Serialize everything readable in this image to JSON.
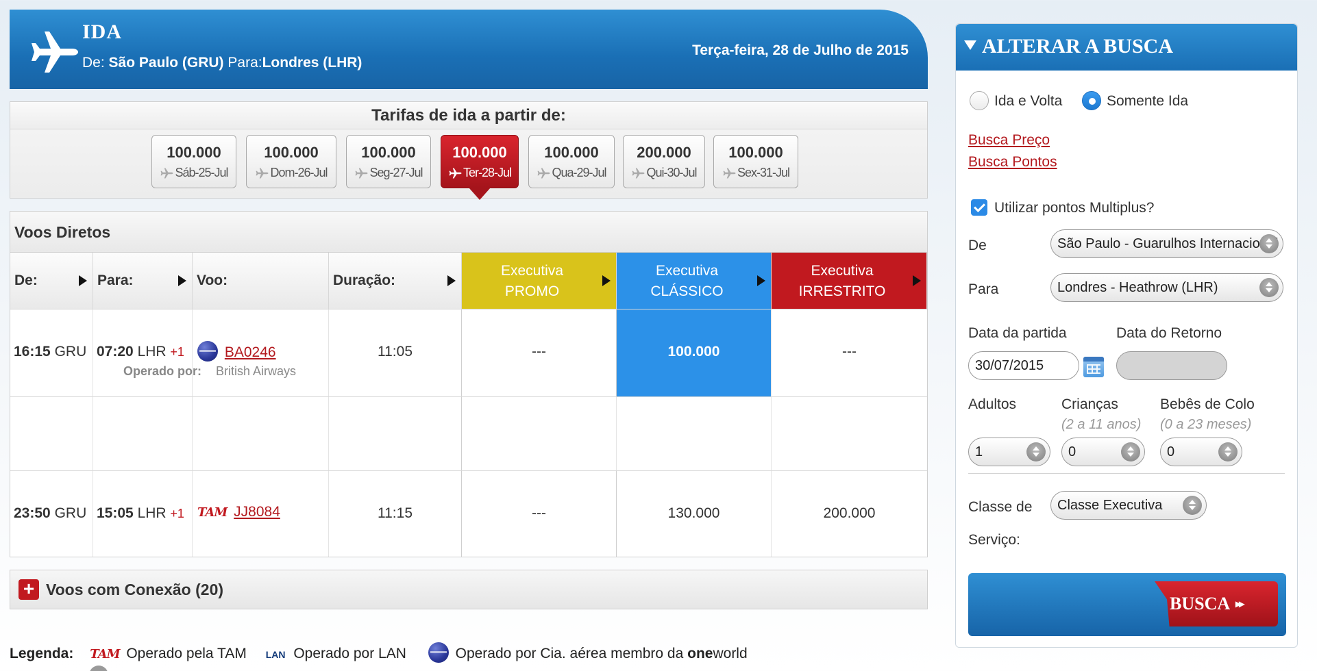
{
  "header": {
    "title": "IDA",
    "route_from_label": "De:",
    "route_from": "São Paulo (GRU)",
    "route_to_label": "Para:",
    "route_to": "Londres (LHR)",
    "date": "Terça-feira, 28 de Julho de 2015"
  },
  "fares": {
    "title": "Tarifas de ida a partir de:",
    "items": [
      {
        "value": "100.000",
        "date": "Sáb-25-Jul",
        "active": false
      },
      {
        "value": "100.000",
        "date": "Dom-26-Jul",
        "active": false
      },
      {
        "value": "100.000",
        "date": "Seg-27-Jul",
        "active": false
      },
      {
        "value": "100.000",
        "date": "Ter-28-Jul",
        "active": true
      },
      {
        "value": "100.000",
        "date": "Qua-29-Jul",
        "active": false
      },
      {
        "value": "200.000",
        "date": "Qui-30-Jul",
        "active": false
      },
      {
        "value": "100.000",
        "date": "Sex-31-Jul",
        "active": false
      }
    ]
  },
  "direct": {
    "title": "Voos Diretos",
    "columns": {
      "de": "De:",
      "para": "Para:",
      "voo": "Voo:",
      "duracao": "Duração:",
      "promo_l1": "Executiva",
      "promo_l2": "PROMO",
      "classico_l1": "Executiva",
      "classico_l2": "CLÁSSICO",
      "irrestrito_l1": "Executiva",
      "irrestrito_l2": "IRRESTRITO"
    },
    "rows": [
      {
        "dep_time": "16:15",
        "dep_airport": "GRU",
        "arr_time": "07:20",
        "arr_airport": "LHR",
        "plus": "+1",
        "flight": "BA0246",
        "operated_label": "Operado por:",
        "operated_by": "British Airways",
        "duration": "11:05",
        "promo": "---",
        "classico": "100.000",
        "irrestrito": "---"
      },
      {
        "dep_time": "23:50",
        "dep_airport": "GRU",
        "arr_time": "15:05",
        "arr_airport": "LHR",
        "plus": "+1",
        "carrier_logo": "TAM",
        "flight": "JJ8084",
        "duration": "11:15",
        "promo": "---",
        "classico": "130.000",
        "irrestrito": "200.000"
      }
    ]
  },
  "connections": {
    "label": "Voos com Conexão (20)"
  },
  "legend": {
    "label": "Legenda:",
    "tam_logo": "TAM",
    "tam": "Operado pela TAM",
    "lan_logo": "LAN",
    "lan": "Operado por LAN",
    "oneworld_prefix": "Operado por Cia. aérea membro da ",
    "oneworld_bold": "one",
    "oneworld_suffix": "world"
  },
  "sidebar": {
    "title": "ALTERAR A BUSCA",
    "trip_roundtrip": "Ida e Volta",
    "trip_oneway": "Somente Ida",
    "link_price": "Busca Preço",
    "link_points": "Busca Pontos",
    "use_points": "Utilizar pontos Multiplus?",
    "from_label": "De",
    "from_value": "São Paulo - Guarulhos Internacional",
    "to_label": "Para",
    "to_value": "Londres - Heathrow (LHR)",
    "depart_label": "Data da partida",
    "return_label": "Data do Retorno",
    "depart_value": "30/07/2015",
    "adults_label": "Adultos",
    "children_label": "Crianças",
    "children_hint": "(2 a 11 anos)",
    "infants_label": "Bebês de Colo",
    "infants_hint": "(0 a 23 meses)",
    "adults_value": "1",
    "children_value": "0",
    "infants_value": "0",
    "class_label_1": "Classe de",
    "class_label_2": "Serviço:",
    "class_value": "Classe Executiva",
    "search_button": "BUSCA"
  },
  "colors": {
    "header_blue": "#1a6fb5",
    "promo": "#d9c31b",
    "classico": "#2c91e8",
    "irrestrito": "#c1191f",
    "active_fare": "#c1191f"
  },
  "icons": [
    "airplane-icon",
    "calendar-icon",
    "oneworld-icon",
    "plus-icon",
    "dropdown-icon",
    "checkbox-icon",
    "radio-icon"
  ]
}
